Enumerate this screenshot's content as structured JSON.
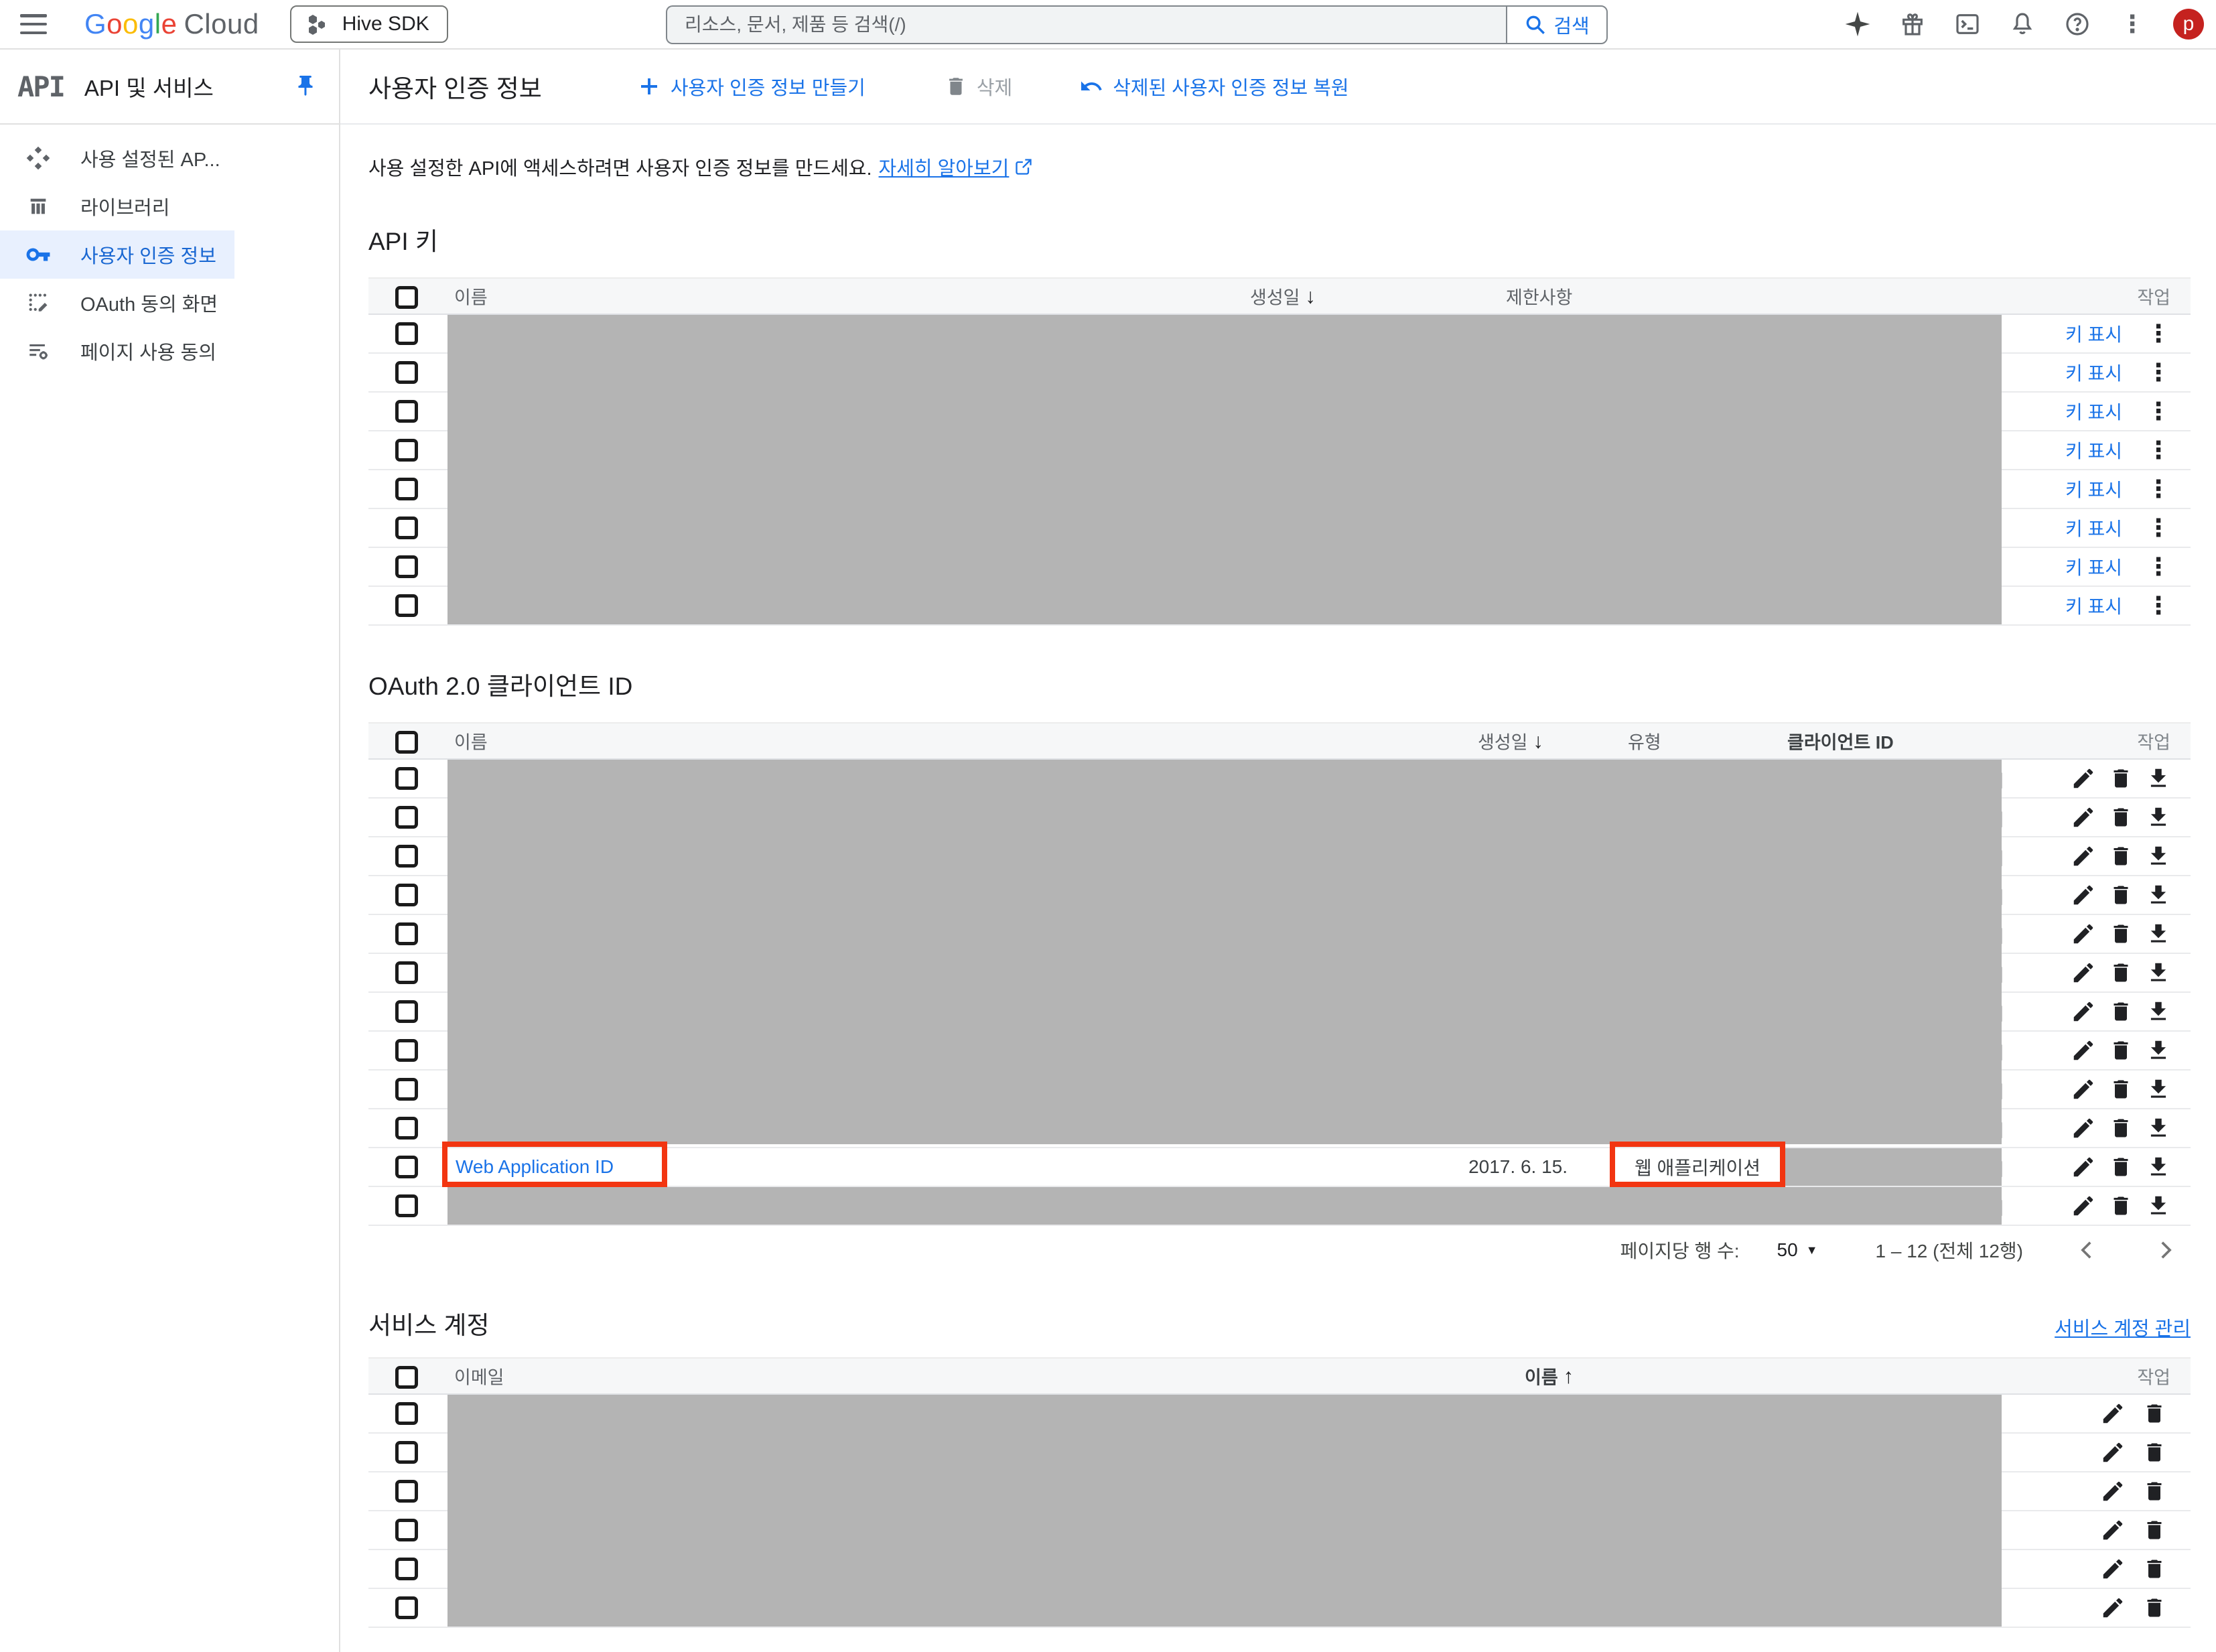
{
  "topbar": {
    "logo_letters": [
      "G",
      "o",
      "o",
      "g",
      "l",
      "e"
    ],
    "logo_cloud": "Cloud",
    "project_selector": "Hive SDK",
    "search_placeholder": "리소스, 문서, 제품 등 검색(/)",
    "search_button": "검색",
    "avatar_initial": "p",
    "icons": [
      "menu-icon",
      "gemini-sparkle-icon",
      "gift-icon",
      "cloud-shell-icon",
      "notifications-bell-icon",
      "help-icon",
      "more-vertical-icon",
      "avatar"
    ]
  },
  "sidebar": {
    "logo": "API",
    "title": "API 및 서비스",
    "pin_icon": "pin-icon",
    "items": [
      {
        "label": "사용 설정된 AP...",
        "icon": "enabled-apis-icon",
        "selected": false
      },
      {
        "label": "라이브러리",
        "icon": "library-icon",
        "selected": false
      },
      {
        "label": "사용자 인증 정보",
        "icon": "key-icon",
        "selected": true
      },
      {
        "label": "OAuth 동의 화면",
        "icon": "oauth-consent-icon",
        "selected": false
      },
      {
        "label": "페이지 사용 동의",
        "icon": "page-agreements-icon",
        "selected": false
      }
    ]
  },
  "toolbar": {
    "title": "사용자 인증 정보",
    "create_label": "사용자 인증 정보 만들기",
    "delete_label": "삭제",
    "restore_label": "삭제된 사용자 인증 정보 복원"
  },
  "intro": {
    "text": "사용 설정한 API에 액세스하려면 사용자 인증 정보를 만드세요.",
    "link": "자세히 알아보기"
  },
  "api_keys": {
    "title": "API 키",
    "columns": {
      "name": "이름",
      "created": "생성일",
      "restrictions": "제한사항",
      "actions": "작업"
    },
    "row_action": "키 표시",
    "row_count": 8,
    "rows_redacted": true
  },
  "oauth": {
    "title": "OAuth 2.0 클라이언트 ID",
    "columns": {
      "name": "이름",
      "created": "생성일",
      "type": "유형",
      "client_id": "클라이언트 ID",
      "actions": "작업"
    },
    "redacted_rows_before": 10,
    "visible_row": {
      "name": "Web Application ID",
      "created": "2017. 6. 15.",
      "type": "웹 애플리케이션",
      "client_id_redacted": true
    },
    "redacted_rows_after": 1
  },
  "pagination": {
    "rows_per_page_label": "페이지당 행 수:",
    "rows_per_page_value": "50",
    "range_label": "1 – 12 (전체 12행)"
  },
  "service_accounts": {
    "title": "서비스 계정",
    "manage_link": "서비스 계정 관리",
    "columns": {
      "email": "이메일",
      "name": "이름",
      "actions": "작업"
    },
    "row_count": 6,
    "rows_redacted": true
  },
  "glyphs": {
    "more_vertical": "⋮",
    "sort_desc": "↓",
    "sort_asc": "↑",
    "dropdown": "▼"
  },
  "colors": {
    "accent_blue": "#1a73e8",
    "selected_nav_bg": "#e8f0fe",
    "redaction_gray": "#b4b4b4",
    "annotation_red": "#f23511",
    "avatar_red": "#c5221f",
    "icon_gray": "#5f6368"
  }
}
